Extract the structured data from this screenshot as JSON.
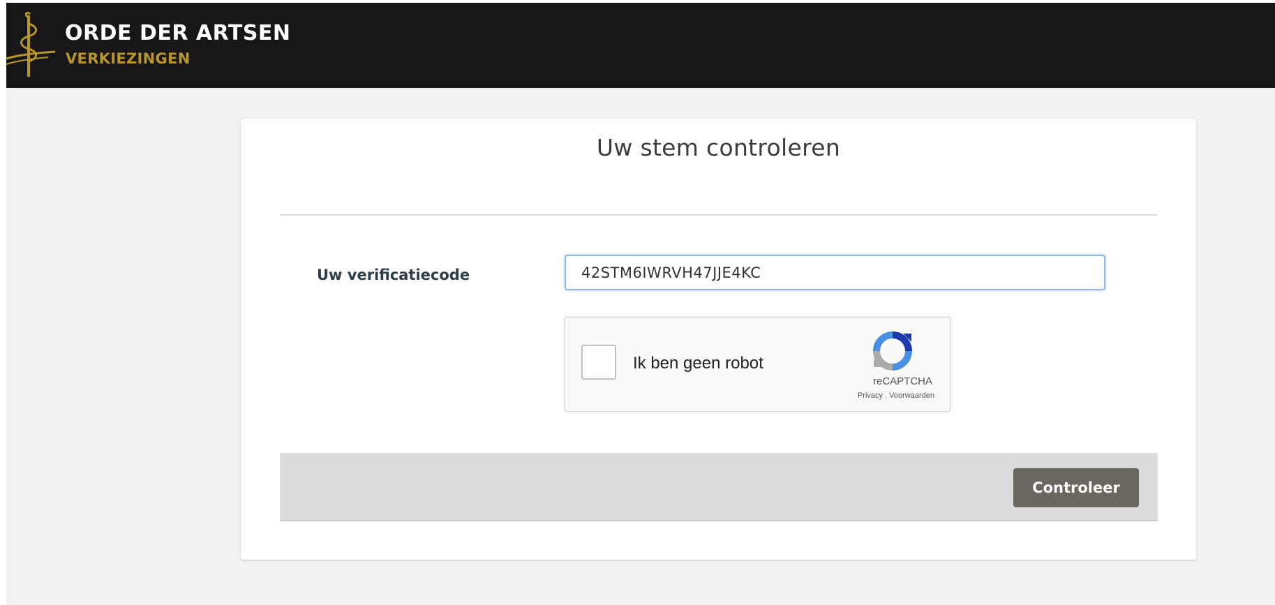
{
  "header": {
    "title": "ORDE DER ARTSEN",
    "subtitle": "VERKIEZINGEN",
    "logo_icon": "caduceus-icon",
    "subtitle_color": "#b7962c"
  },
  "form": {
    "title": "Uw stem controleren",
    "code_label": "Uw verificatiecode",
    "code_value": "42STM6IWRVH47JJE4KC",
    "captcha": {
      "label": "Ik ben geen robot",
      "brand": "reCAPTCHA",
      "links": "Privacy . Voorwaarden",
      "checked": false
    },
    "submit_label": "Controleer"
  }
}
